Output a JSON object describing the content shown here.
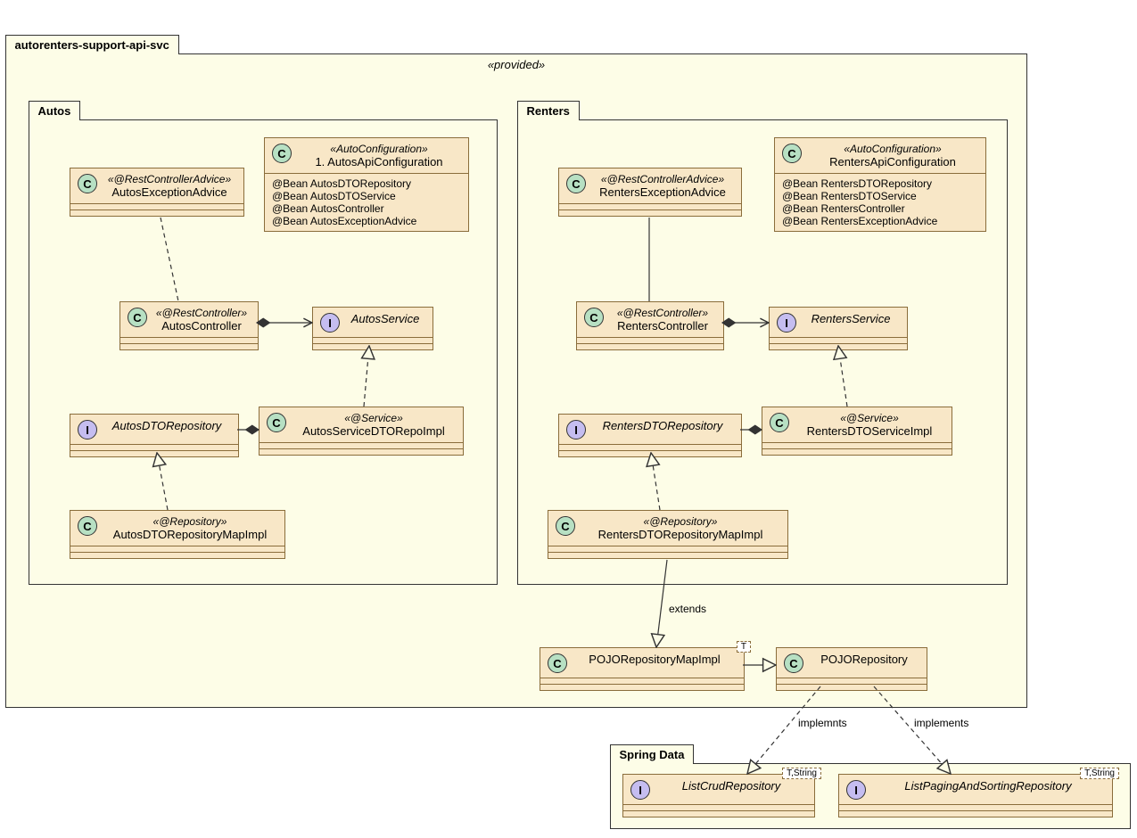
{
  "outer": {
    "tab": "autorenters-support-api-svc",
    "stereo": "«provided»"
  },
  "autos": {
    "tab": "Autos",
    "advice": {
      "stereo": "«@RestControllerAdvice»",
      "name": "AutosExceptionAdvice"
    },
    "config": {
      "stereo": "«AutoConfiguration»",
      "name": "1. AutosApiConfiguration",
      "beans": [
        "@Bean AutosDTORepository",
        "@Bean AutosDTOService",
        "@Bean AutosController",
        "@Bean AutosExceptionAdvice"
      ]
    },
    "controller": {
      "stereo": "«@RestController»",
      "name": "AutosController"
    },
    "service": {
      "name": "AutosService"
    },
    "dtoRepo": {
      "name": "AutosDTORepository"
    },
    "serviceImpl": {
      "stereo": "«@Service»",
      "name": "AutosServiceDTORepoImpl"
    },
    "repoImpl": {
      "stereo": "«@Repository»",
      "name": "AutosDTORepositoryMapImpl"
    }
  },
  "renters": {
    "tab": "Renters",
    "advice": {
      "stereo": "«@RestControllerAdvice»",
      "name": "RentersExceptionAdvice"
    },
    "config": {
      "stereo": "«AutoConfiguration»",
      "name": "RentersApiConfiguration",
      "beans": [
        "@Bean RentersDTORepository",
        "@Bean RentersDTOService",
        "@Bean RentersController",
        "@Bean RentersExceptionAdvice"
      ]
    },
    "controller": {
      "stereo": "«@RestController»",
      "name": "RentersController"
    },
    "service": {
      "name": "RentersService"
    },
    "dtoRepo": {
      "name": "RentersDTORepository"
    },
    "serviceImpl": {
      "stereo": "«@Service»",
      "name": "RentersDTOServiceImpl"
    },
    "repoImpl": {
      "stereo": "«@Repository»",
      "name": "RentersDTORepositoryMapImpl"
    }
  },
  "pojo": {
    "mapImpl": {
      "name": "POJORepositoryMapImpl",
      "template": "T"
    },
    "repo": {
      "name": "POJORepository"
    }
  },
  "spring": {
    "tab": "Spring Data",
    "listCrud": {
      "name": "ListCrudRepository",
      "template": "T,String"
    },
    "listPaging": {
      "name": "ListPagingAndSortingRepository",
      "template": "T,String"
    }
  },
  "labels": {
    "extends": "extends",
    "implemnts": "implemnts",
    "implements": "implements"
  }
}
